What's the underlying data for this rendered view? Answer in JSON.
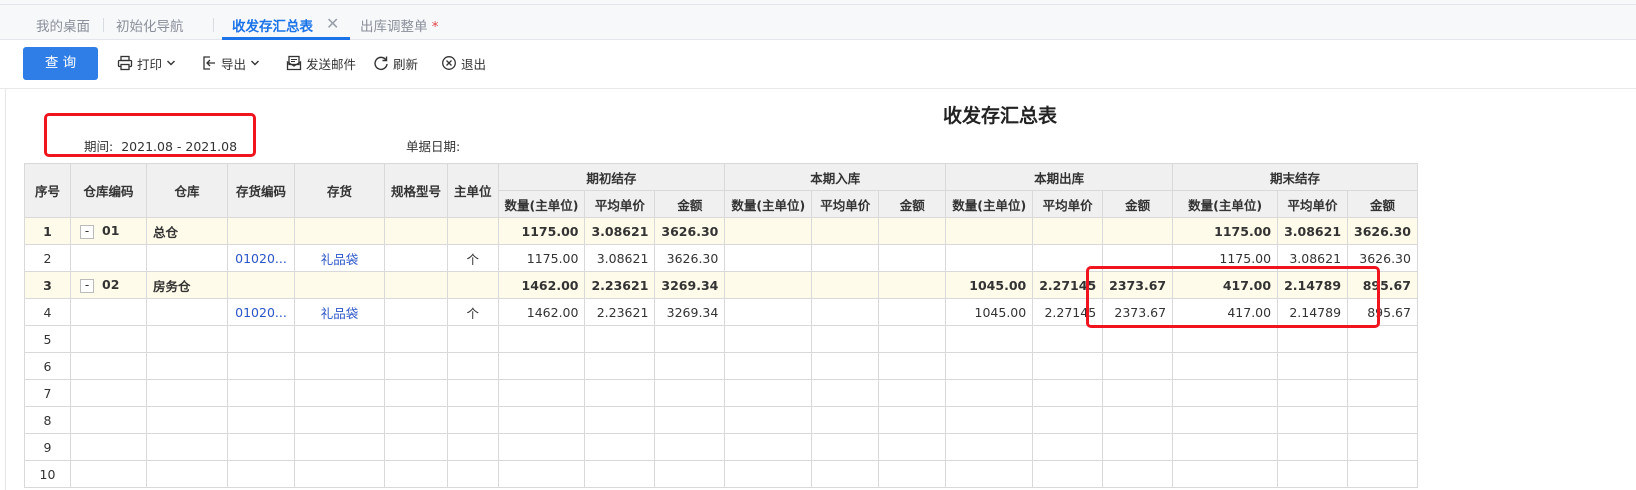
{
  "tabs": [
    {
      "label": "我的桌面"
    },
    {
      "label": "初始化导航"
    },
    {
      "label": "收发存汇总表"
    },
    {
      "label": "出库调整单",
      "marker": "*"
    }
  ],
  "toolbar": {
    "query": "查 询",
    "print": "打印",
    "export": "导出",
    "email": "发送邮件",
    "refresh": "刷新",
    "exit": "退出"
  },
  "report": {
    "title": "收发存汇总表",
    "period_label": "期间:",
    "period_value": "2021.08 - 2021.08",
    "doc_date_label": "单据日期:"
  },
  "table": {
    "headers": {
      "seq": "序号",
      "wh_code": "仓库编码",
      "wh": "仓库",
      "item_code": "存货编码",
      "item": "存货",
      "spec": "规格型号",
      "unit": "主单位",
      "opening": "期初结存",
      "in": "本期入库",
      "out": "本期出库",
      "closing": "期末结存",
      "qty": "数量(主单位)",
      "avg": "平均单价",
      "amt": "金额"
    },
    "rows": [
      {
        "seq": "1",
        "expander": "-",
        "wh_code": "01",
        "wh": "总仓",
        "item_code": "",
        "item": "",
        "spec": "",
        "unit": "",
        "op_qty": "1175.00",
        "op_avg": "3.08621",
        "op_amt": "3626.30",
        "in_qty": "",
        "in_avg": "",
        "in_amt": "",
        "out_qty": "",
        "out_avg": "",
        "out_amt": "",
        "cl_qty": "1175.00",
        "cl_avg": "3.08621",
        "cl_amt": "3626.30",
        "subtotal": true
      },
      {
        "seq": "2",
        "expander": "",
        "wh_code": "",
        "wh": "",
        "item_code": "01020...",
        "item": "礼品袋",
        "spec": "",
        "unit": "个",
        "op_qty": "1175.00",
        "op_avg": "3.08621",
        "op_amt": "3626.30",
        "in_qty": "",
        "in_avg": "",
        "in_amt": "",
        "out_qty": "",
        "out_avg": "",
        "out_amt": "",
        "cl_qty": "1175.00",
        "cl_avg": "3.08621",
        "cl_amt": "3626.30",
        "subtotal": false
      },
      {
        "seq": "3",
        "expander": "-",
        "wh_code": "02",
        "wh": "房务仓",
        "item_code": "",
        "item": "",
        "spec": "",
        "unit": "",
        "op_qty": "1462.00",
        "op_avg": "2.23621",
        "op_amt": "3269.34",
        "in_qty": "",
        "in_avg": "",
        "in_amt": "",
        "out_qty": "1045.00",
        "out_avg": "2.27145",
        "out_amt": "2373.67",
        "cl_qty": "417.00",
        "cl_avg": "2.14789",
        "cl_amt": "895.67",
        "subtotal": true
      },
      {
        "seq": "4",
        "expander": "",
        "wh_code": "",
        "wh": "",
        "item_code": "01020...",
        "item": "礼品袋",
        "spec": "",
        "unit": "个",
        "op_qty": "1462.00",
        "op_avg": "2.23621",
        "op_amt": "3269.34",
        "in_qty": "",
        "in_avg": "",
        "in_amt": "",
        "out_qty": "1045.00",
        "out_avg": "2.27145",
        "out_amt": "2373.67",
        "cl_qty": "417.00",
        "cl_avg": "2.14789",
        "cl_amt": "895.67",
        "subtotal": false
      },
      {
        "seq": "5"
      },
      {
        "seq": "6"
      },
      {
        "seq": "7"
      },
      {
        "seq": "8"
      },
      {
        "seq": "9"
      },
      {
        "seq": "10"
      }
    ]
  },
  "colors": {
    "accent": "#2f7ee8",
    "highlight_box": "#f0141e",
    "subtotal_bg": "#fffbea",
    "link": "#2b55c7"
  }
}
